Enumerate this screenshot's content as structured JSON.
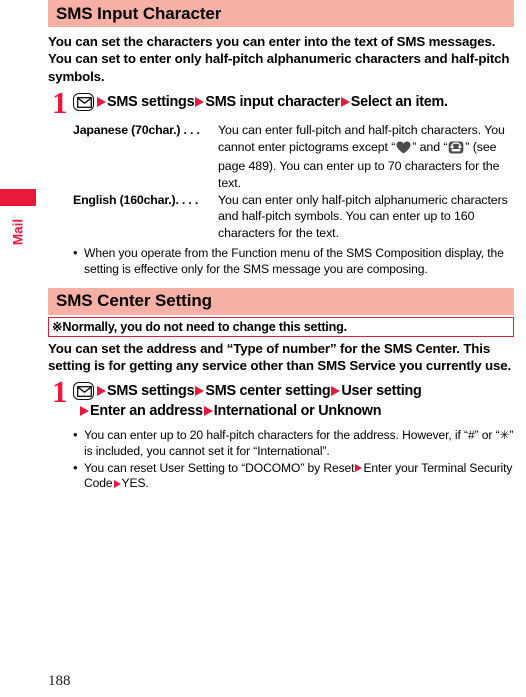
{
  "sidebar": {
    "tab_label": "Mail",
    "tab_color": "#e8193c"
  },
  "colors": {
    "heading_bg": "#f7b0a5",
    "accent_red": "#e8193c",
    "note_border": "#d8223f"
  },
  "sections": [
    {
      "heading": "SMS Input Character",
      "intro": "You can set the characters you can enter into the text of SMS messages. You can set to enter only half-pitch alphanumeric characters and half-pitch symbols.",
      "step": {
        "number": "1",
        "icon": "mail-key-icon",
        "line1": [
          "SMS settings",
          "SMS input character",
          "Select an item."
        ]
      },
      "definitions": [
        {
          "term": "Japanese (70char.) . . .",
          "desc_pre": "You can enter full-pitch and half-pitch characters. You cannot enter pictograms except “",
          "picto1": "heart-pictogram",
          "desc_mid": "” and “",
          "picto2": "telephone-pictogram",
          "desc_post": "” (see page 489). You can enter up to 70 characters for the text."
        },
        {
          "term": "English (160char.). . . .",
          "desc_pre": "You can enter only half-pitch alphanumeric characters and half-pitch symbols. You can enter up to 160 characters for the text.",
          "picto1": "",
          "desc_mid": "",
          "picto2": "",
          "desc_post": ""
        }
      ],
      "bullets": [
        "When you operate from the Function menu of the SMS Composition display, the setting is effective only for the SMS message you are composing."
      ]
    },
    {
      "heading": "SMS Center Setting",
      "note": "※Normally, you do not need to change this setting.",
      "intro": "You can set the address and “Type of number” for the SMS Center. This setting is for getting any service other than SMS Service you currently use.",
      "step": {
        "number": "1",
        "icon": "mail-key-icon",
        "line1": [
          "SMS settings",
          "SMS center setting",
          "User setting"
        ],
        "line2": [
          "Enter an address",
          "International or Unknown"
        ]
      },
      "bullets": [
        {
          "pre": "You can enter up to 20 half-pitch characters for the address. However, if “#” or “✳” is included, you cannot set it for “International”."
        },
        {
          "seg1": "You can reset User Setting to “DOCOMO” by Reset",
          "seg2": "Enter your Terminal Security Code",
          "seg3": "YES."
        }
      ]
    }
  ],
  "footer": {
    "page_number": "188"
  }
}
